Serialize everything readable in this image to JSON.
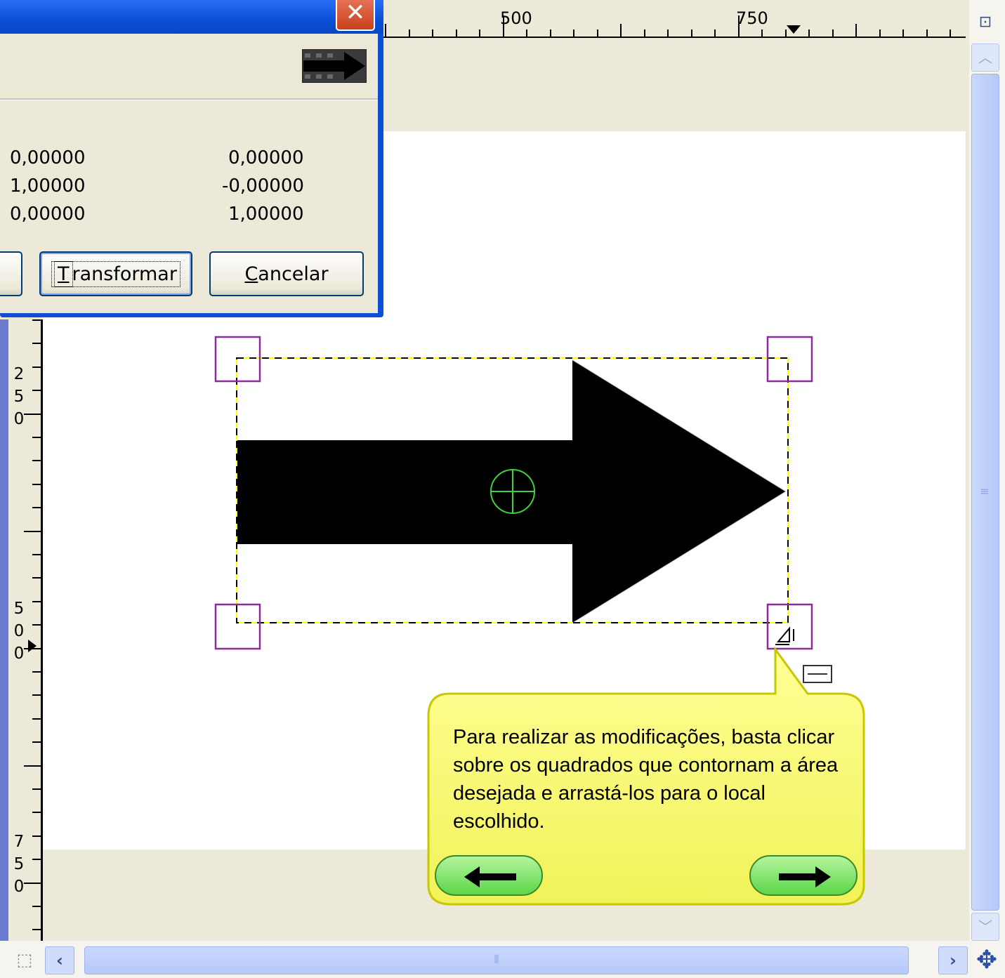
{
  "dialog": {
    "matrix": [
      [
        "0,00000",
        "0,00000"
      ],
      [
        "1,00000",
        "-0,00000"
      ],
      [
        "0,00000",
        "1,00000"
      ]
    ],
    "buttons": {
      "transform_label": "Transformar",
      "cancel_label": "Cancelar"
    },
    "close_icon": "close-icon",
    "preview_icon": "arrow-preview-icon"
  },
  "rulers": {
    "horizontal_labels": [
      "500",
      "750"
    ],
    "vertical_labels": [
      "250",
      "500",
      "750"
    ]
  },
  "tooltip": {
    "text": "Para realizar as modificações, basta clicar sobre os quadrados que contornam a área desejada e arrastá-los para o local escolhido.",
    "back_icon": "arrow-left-icon",
    "next_icon": "arrow-right-icon"
  },
  "colors": {
    "titlebar": "#0a4fd4",
    "handle": "#8e2a9c",
    "center_marker": "#3fd23f",
    "tooltip_bg": "#ffff80",
    "nav_button": "#5cd64a"
  }
}
